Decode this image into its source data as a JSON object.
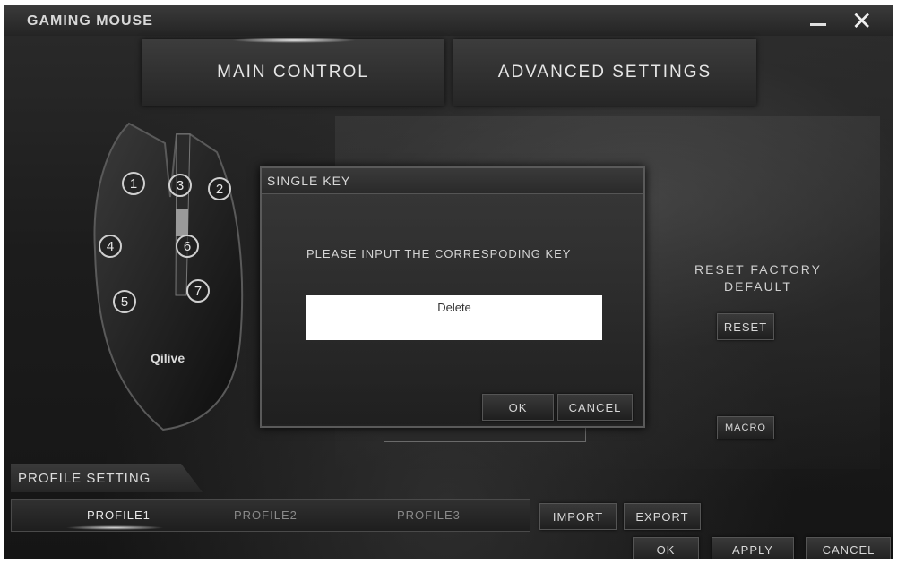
{
  "window": {
    "title": "GAMING MOUSE"
  },
  "tabs": [
    {
      "label": "MAIN CONTROL",
      "active": true
    },
    {
      "label": "ADVANCED SETTINGS",
      "active": false
    }
  ],
  "mouse": {
    "buttons": [
      "1",
      "2",
      "3",
      "4",
      "5",
      "6",
      "7"
    ],
    "brand": "Qilive"
  },
  "reset": {
    "label": "RESET FACTORY DEFAULT",
    "button": "RESET"
  },
  "macro": {
    "button": "MACRO"
  },
  "dialog": {
    "title": "SINGLE KEY",
    "prompt": "PLEASE INPUT THE CORRESPODING KEY",
    "input_value": "Delete",
    "ok": "OK",
    "cancel": "CANCEL"
  },
  "profile": {
    "heading": "PROFILE SETTING",
    "items": [
      "PROFILE1",
      "PROFILE2",
      "PROFILE3"
    ],
    "active_index": 0,
    "import": "IMPORT",
    "export": "EXPORT"
  },
  "footer": {
    "ok": "OK",
    "apply": "APPLY",
    "cancel": "CANCEL"
  }
}
